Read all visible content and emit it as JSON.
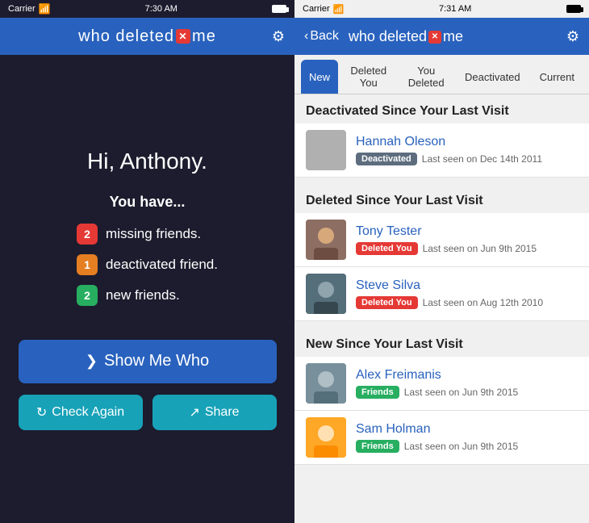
{
  "left": {
    "statusBar": {
      "carrier": "Carrier",
      "time": "7:30 AM"
    },
    "appTitle": "who deleted",
    "appTitleSuffix": "me",
    "gearLabel": "⚙",
    "greeting": "Hi, Anthony.",
    "youHave": "You have...",
    "stats": [
      {
        "count": "2",
        "badgeClass": "badge-red",
        "text": "missing friends."
      },
      {
        "count": "1",
        "badgeClass": "badge-orange",
        "text": "deactivated friend."
      },
      {
        "count": "2",
        "badgeClass": "badge-green",
        "text": "new friends."
      }
    ],
    "showMeWho": "Show Me Who",
    "checkAgain": "Check Again",
    "share": "Share"
  },
  "right": {
    "statusBar": {
      "carrier": "Carrier",
      "time": "7:31 AM"
    },
    "back": "Back",
    "appTitle": "who deleted",
    "appTitleSuffix": "me",
    "gearLabel": "⚙",
    "tabs": [
      {
        "label": "New",
        "active": true
      },
      {
        "label": "Deleted You",
        "active": false
      },
      {
        "label": "You Deleted",
        "active": false
      },
      {
        "label": "Deactivated",
        "active": false
      },
      {
        "label": "Current",
        "active": false
      }
    ],
    "sections": [
      {
        "title": "Deactivated Since Your Last Visit",
        "people": [
          {
            "name": "Hannah Oleson",
            "tag": "Deactivated",
            "tagClass": "tag-deactivated",
            "lastSeen": "Last seen on Dec 14th 2011",
            "avatarClass": "avatar-placeholder"
          }
        ]
      },
      {
        "title": "Deleted Since Your Last Visit",
        "people": [
          {
            "name": "Tony Tester",
            "tag": "Deleted You",
            "tagClass": "tag-deleted-you",
            "lastSeen": "Last seen on Jun 9th 2015",
            "avatarClass": "avatar-tony"
          },
          {
            "name": "Steve Silva",
            "tag": "Deleted You",
            "tagClass": "tag-deleted-you",
            "lastSeen": "Last seen on Aug 12th 2010",
            "avatarClass": "avatar-steve"
          }
        ]
      },
      {
        "title": "New Since Your Last Visit",
        "people": [
          {
            "name": "Alex Freimanis",
            "tag": "Friends",
            "tagClass": "tag-friends",
            "lastSeen": "Last seen on Jun 9th 2015",
            "avatarClass": "avatar-alex"
          },
          {
            "name": "Sam Holman",
            "tag": "Friends",
            "tagClass": "tag-friends",
            "lastSeen": "Last seen on Jun 9th 2015",
            "avatarClass": "avatar-sam"
          }
        ]
      }
    ]
  }
}
